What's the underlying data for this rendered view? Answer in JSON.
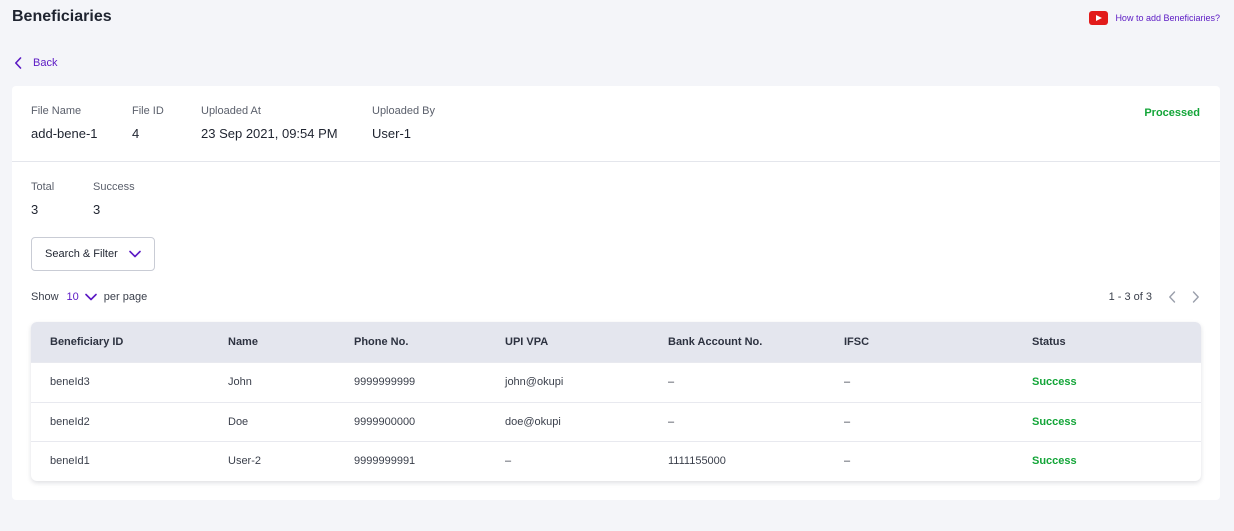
{
  "page": {
    "title": "Beneficiaries"
  },
  "help": {
    "label": "How to add Beneficiaries?",
    "icon": "youtube-icon"
  },
  "back": {
    "label": "Back",
    "icon": "chevron-left-icon"
  },
  "file": {
    "fields": [
      {
        "label": "File Name",
        "value": "add-bene-1"
      },
      {
        "label": "File ID",
        "value": "4"
      },
      {
        "label": "Uploaded At",
        "value": "23 Sep 2021, 09:54 PM"
      },
      {
        "label": "Uploaded By",
        "value": "User-1"
      }
    ],
    "status": "Processed"
  },
  "stats": [
    {
      "label": "Total",
      "value": "3"
    },
    {
      "label": "Success",
      "value": "3"
    }
  ],
  "filter": {
    "label": "Search & Filter",
    "icon": "chevron-down-icon"
  },
  "pagination": {
    "show_label": "Show",
    "page_size": "10",
    "per_page_label": "per page",
    "range": "1 - 3 of 3"
  },
  "table": {
    "columns": [
      "Beneficiary ID",
      "Name",
      "Phone No.",
      "UPI VPA",
      "Bank Account No.",
      "IFSC",
      "Status"
    ],
    "rows": [
      [
        "beneId3",
        "John",
        "9999999999",
        "john@okupi",
        "–",
        "–",
        "Success"
      ],
      [
        "beneId2",
        "Doe",
        "9999900000",
        "doe@okupi",
        "–",
        "–",
        "Success"
      ],
      [
        "beneId1",
        "User-2",
        "9999999991",
        "–",
        "1111155000",
        "–",
        "Success"
      ]
    ]
  },
  "colors": {
    "accent": "#5b19c4",
    "success": "#13a538",
    "youtube": "#e21b1b"
  }
}
